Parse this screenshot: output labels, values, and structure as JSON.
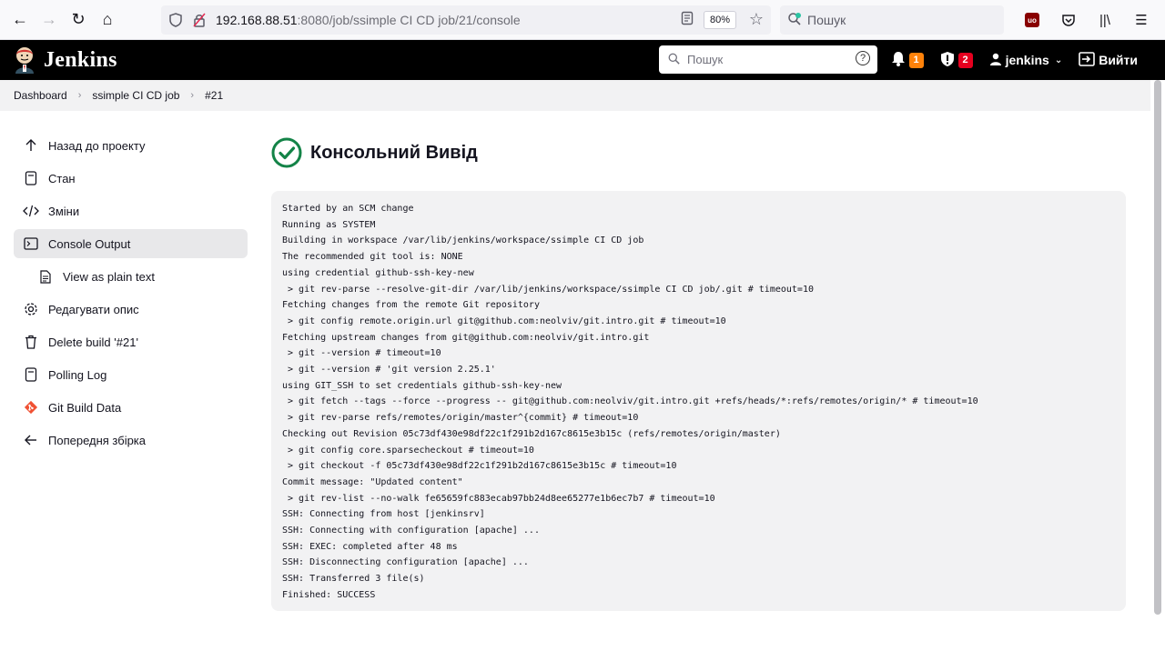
{
  "browser": {
    "url_host": "192.168.88.51",
    "url_path": ":8080/job/ssimple CI CD job/21/console",
    "zoom": "80%",
    "search_placeholder": "Пошук"
  },
  "header": {
    "title": "Jenkins",
    "search_placeholder": "Пошук",
    "notifications_count": "1",
    "security_count": "2",
    "user": "jenkins",
    "logout": "Вийти"
  },
  "breadcrumb": [
    "Dashboard",
    "ssimple CI CD job",
    "#21"
  ],
  "sidebar": {
    "items": [
      {
        "label": "Назад до проекту",
        "icon": "arrow-up-icon"
      },
      {
        "label": "Стан",
        "icon": "document-icon"
      },
      {
        "label": "Зміни",
        "icon": "code-icon"
      },
      {
        "label": "Console Output",
        "icon": "terminal-icon"
      },
      {
        "label": "View as plain text",
        "icon": "file-icon"
      },
      {
        "label": "Редагувати опис",
        "icon": "gear-icon"
      },
      {
        "label": "Delete build '#21'",
        "icon": "trash-icon"
      },
      {
        "label": "Polling Log",
        "icon": "log-icon"
      },
      {
        "label": "Git Build Data",
        "icon": "git-icon"
      },
      {
        "label": "Попередня збірка",
        "icon": "arrow-left-icon"
      }
    ]
  },
  "main": {
    "title": "Консольний Вивід",
    "console_lines": [
      "Started by an SCM change",
      "Running as SYSTEM",
      "Building in workspace /var/lib/jenkins/workspace/ssimple CI CD job",
      "The recommended git tool is: NONE",
      "using credential github-ssh-key-new",
      " > git rev-parse --resolve-git-dir /var/lib/jenkins/workspace/ssimple CI CD job/.git # timeout=10",
      "Fetching changes from the remote Git repository",
      " > git config remote.origin.url git@github.com:neolviv/git.intro.git # timeout=10",
      "Fetching upstream changes from git@github.com:neolviv/git.intro.git",
      " > git --version # timeout=10",
      " > git --version # 'git version 2.25.1'",
      "using GIT_SSH to set credentials github-ssh-key-new",
      " > git fetch --tags --force --progress -- git@github.com:neolviv/git.intro.git +refs/heads/*:refs/remotes/origin/* # timeout=10",
      " > git rev-parse refs/remotes/origin/master^{commit} # timeout=10",
      "Checking out Revision 05c73df430e98df22c1f291b2d167c8615e3b15c (refs/remotes/origin/master)",
      " > git config core.sparsecheckout # timeout=10",
      " > git checkout -f 05c73df430e98df22c1f291b2d167c8615e3b15c # timeout=10",
      "Commit message: \"Updated content\"",
      " > git rev-list --no-walk fe65659fc883ecab97bb24d8ee65277e1b6ec7b7 # timeout=10",
      "SSH: Connecting from host [jenkinsrv]",
      "SSH: Connecting with configuration [apache] ...",
      "SSH: EXEC: completed after 48 ms",
      "SSH: Disconnecting configuration [apache] ...",
      "SSH: Transferred 3 file(s)",
      "Finished: SUCCESS"
    ]
  }
}
